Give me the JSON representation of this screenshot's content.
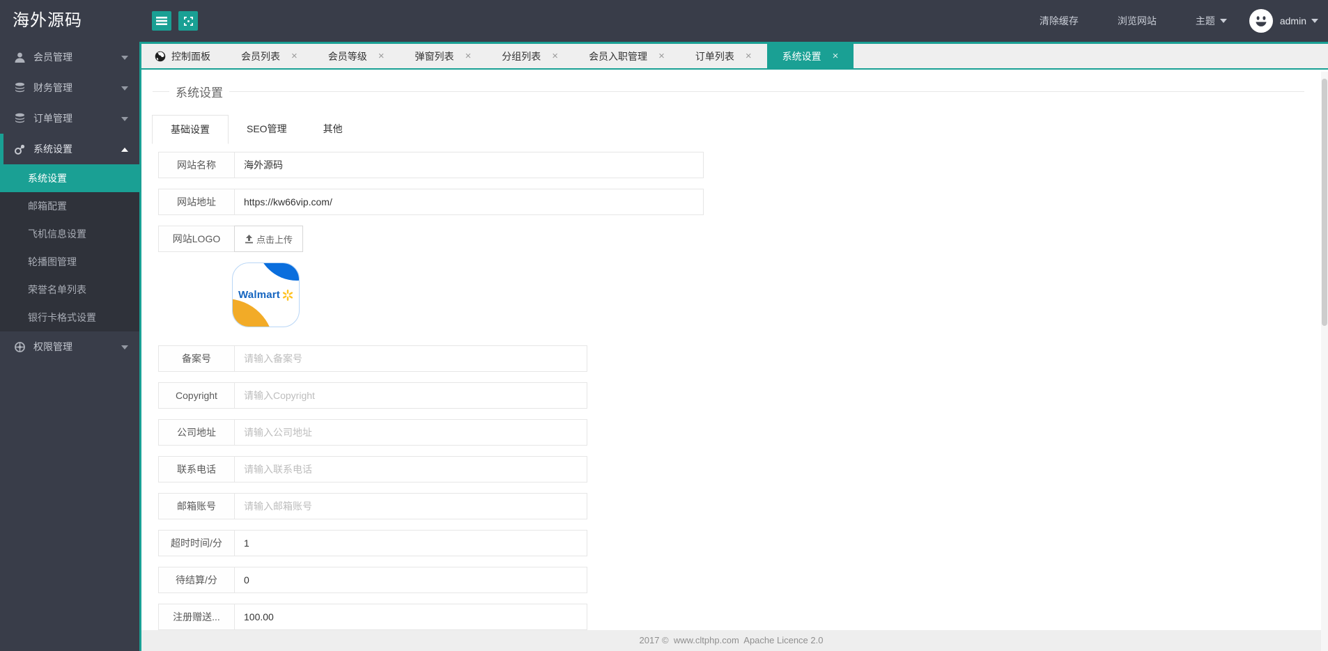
{
  "app": {
    "logo_text": "海外源码"
  },
  "colors": {
    "accent_teal": "#1AA094",
    "dark_bar": "#393D49",
    "submenu_bg": "#2F323A",
    "tabstrip_bg": "#EFEFEF",
    "footer_bg": "#EEEEEE",
    "walmart_blue": "#0A6EDD",
    "walmart_yellow": "#F2AB27",
    "walmart_spark": "#FFC220"
  },
  "sidebar": {
    "items": [
      {
        "label": "会员管理",
        "icon": "user-icon",
        "expanded": false
      },
      {
        "label": "财务管理",
        "icon": "database-icon",
        "expanded": false
      },
      {
        "label": "订单管理",
        "icon": "database-icon",
        "expanded": false
      },
      {
        "label": "系统设置",
        "icon": "settings-icon",
        "expanded": true,
        "children": [
          "系统设置",
          "邮箱配置",
          "飞机信息设置",
          "轮播图管理",
          "荣誉名单列表",
          "银行卡格式设置"
        ],
        "active_child": "系统设置"
      },
      {
        "label": "权限管理",
        "icon": "wheel-icon",
        "expanded": false
      }
    ]
  },
  "topbar": {
    "clear_cache": "清除缓存",
    "browse_site": "浏览网站",
    "theme": "主题",
    "username": "admin"
  },
  "window_tabs": [
    {
      "label": "控制面板",
      "closable": false,
      "active": false
    },
    {
      "label": "会员列表",
      "closable": true,
      "active": false
    },
    {
      "label": "会员等级",
      "closable": true,
      "active": false
    },
    {
      "label": "弹窗列表",
      "closable": true,
      "active": false
    },
    {
      "label": "分组列表",
      "closable": true,
      "active": false
    },
    {
      "label": "会员入职管理",
      "closable": true,
      "active": false
    },
    {
      "label": "订单列表",
      "closable": true,
      "active": false
    },
    {
      "label": "系统设置",
      "closable": true,
      "active": true
    }
  ],
  "close_glyph": "×",
  "page": {
    "heading": "系统设置",
    "content_tabs": [
      {
        "label": "基础设置",
        "active": true
      },
      {
        "label": "SEO管理",
        "active": false
      },
      {
        "label": "其他",
        "active": false
      }
    ],
    "form": {
      "rows": [
        {
          "label": "网站名称",
          "value": "海外源码"
        },
        {
          "label": "网站地址",
          "value": "https://kw66vip.com/"
        },
        {
          "label": "网站LOGO",
          "upload_button": "点击上传"
        },
        {
          "label": "备案号",
          "placeholder": "请输入备案号"
        },
        {
          "label": "Copyright",
          "placeholder": "请输入Copyright"
        },
        {
          "label": "公司地址",
          "placeholder": "请输入公司地址"
        },
        {
          "label": "联系电话",
          "placeholder": "请输入联系电话"
        },
        {
          "label": "邮箱账号",
          "placeholder": "请输入邮箱账号"
        },
        {
          "label": "超时时间/分",
          "value": "1"
        },
        {
          "label": "待结算/分",
          "value": "0"
        },
        {
          "label": "注册赠送...",
          "value": "100.00"
        }
      ],
      "logo_preview_text": "Walmart"
    }
  },
  "footer": {
    "text": "2017 ©  www.cltphp.com  Apache Licence 2.0"
  }
}
